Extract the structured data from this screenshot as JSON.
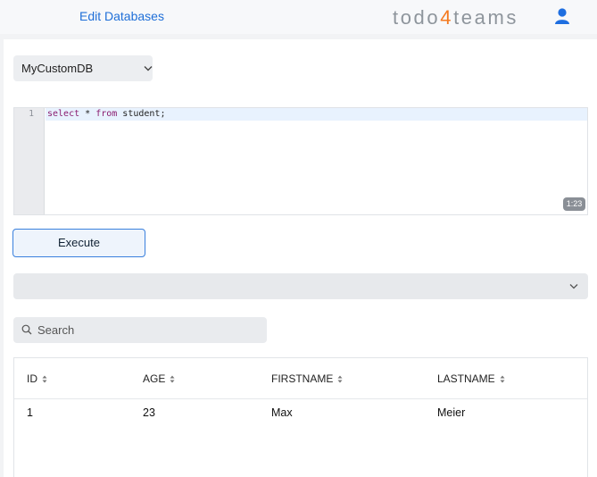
{
  "header": {
    "title": "Edit Databases",
    "brand_prefix": "todo",
    "brand_accent": "4",
    "brand_suffix": "teams"
  },
  "db_select": {
    "value": "MyCustomDB"
  },
  "editor": {
    "line_number": "1",
    "code": {
      "kw1": "select",
      "mid": " * ",
      "kw2": "from",
      "rest": " student;"
    },
    "cursor_position": "1:23"
  },
  "execute_label": "Execute",
  "search": {
    "placeholder": "Search"
  },
  "table": {
    "columns": [
      "ID",
      "AGE",
      "FIRSTNAME",
      "LASTNAME"
    ],
    "rows": [
      [
        "1",
        "23",
        "Max",
        "Meier"
      ]
    ]
  },
  "colors": {
    "accent": "#1f6fd8",
    "brand_accent": "#f47a20",
    "button_border": "#3a80dd"
  },
  "icons": [
    "user-icon",
    "chevron-down-icon",
    "search-icon",
    "sort-icon"
  ]
}
